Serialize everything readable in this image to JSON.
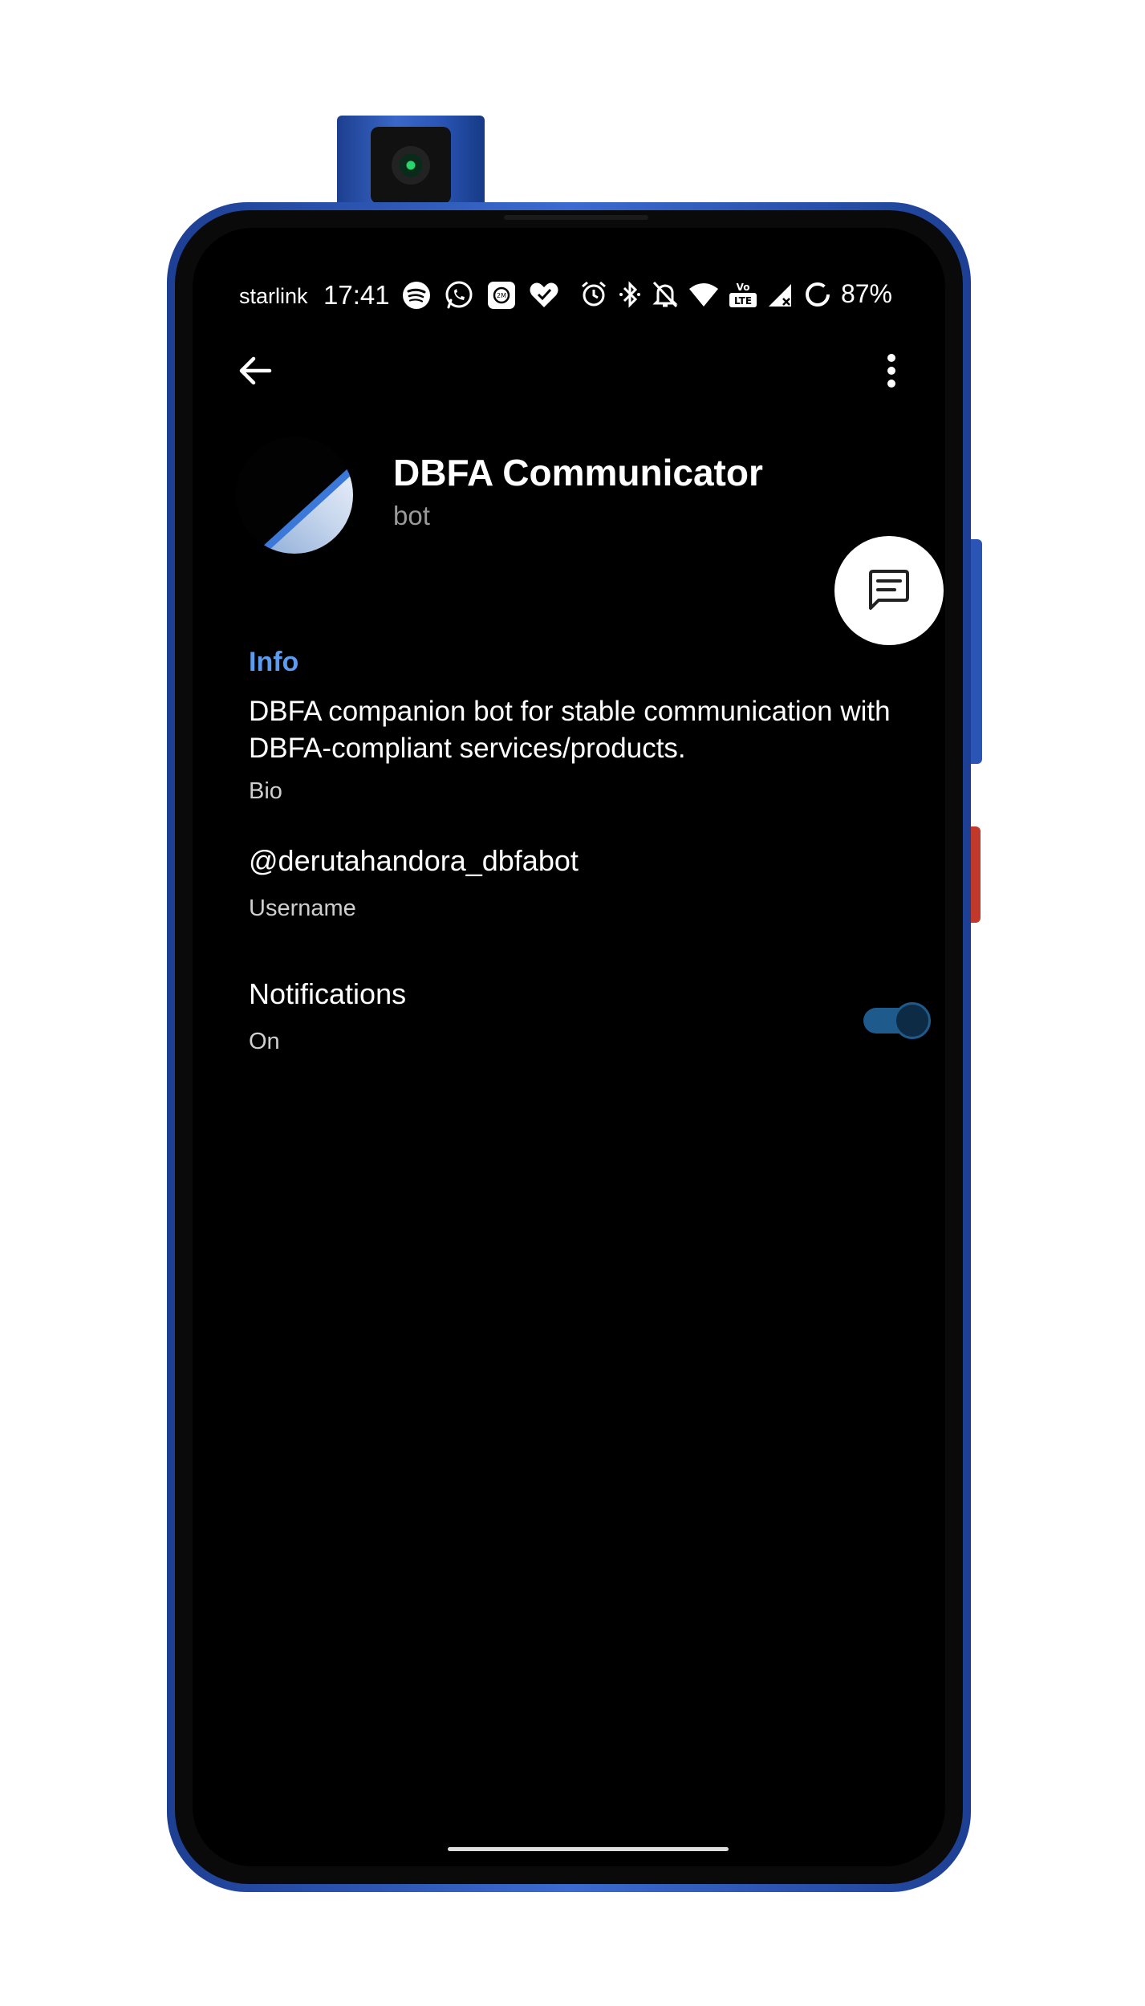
{
  "status_bar": {
    "carrier": "starlink",
    "time": "17:41",
    "battery": "87%",
    "left_icons": [
      "spotify-icon",
      "whatsapp-icon",
      "app-badge-icon",
      "heart-check-icon"
    ],
    "right_icons": [
      "alarm-icon",
      "bluetooth-icon",
      "notifications-off-icon",
      "wifi-icon",
      "volte-icon",
      "signal-icon",
      "battery-saver-icon"
    ]
  },
  "app_bar": {
    "back_icon": "arrow-back-icon",
    "menu_icon": "more-vertical-icon"
  },
  "profile": {
    "name": "DBFA Communicator",
    "subtitle": "bot",
    "avatar": "earth-horizon-avatar",
    "fab_icon": "message-icon"
  },
  "info": {
    "section_title": "Info",
    "bio": "DBFA companion bot for stable communication with DBFA-compliant services/products.",
    "bio_label": "Bio",
    "username": "@derutahandora_dbfabot",
    "username_label": "Username",
    "notifications_label": "Notifications",
    "notifications_value": "On",
    "notifications_enabled": true
  },
  "colors": {
    "background": "#000000",
    "accent": "#5b9cf0",
    "toggle_track": "#1e5a8c",
    "frame": "#2a55b5"
  }
}
